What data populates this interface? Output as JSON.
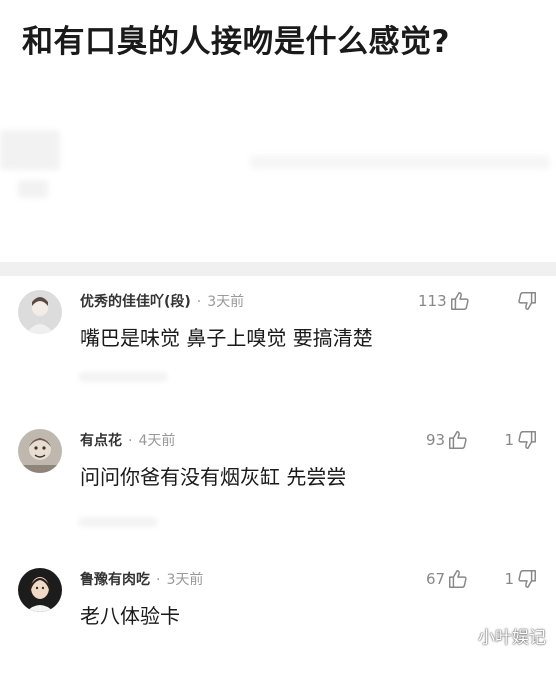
{
  "question": {
    "title": "和有口臭的人接吻是什么感觉?"
  },
  "comments": [
    {
      "username": "优秀的佳佳吖(段)",
      "time": "3天前",
      "text": "嘴巴是味觉 鼻子上嗅觉 要搞清楚",
      "likes": "113",
      "dislikes": ""
    },
    {
      "username": "有点花",
      "time": "4天前",
      "text": "问问你爸有没有烟灰缸 先尝尝",
      "likes": "93",
      "dislikes": "1"
    },
    {
      "username": "鲁豫有肉吃",
      "time": "3天前",
      "text": "老八体验卡",
      "likes": "67",
      "dislikes": "1"
    }
  ],
  "meta_separator": "·",
  "icons": {
    "like": "thumbs-up-icon",
    "dislike": "thumbs-down-icon"
  },
  "watermark": "小叶娱记"
}
